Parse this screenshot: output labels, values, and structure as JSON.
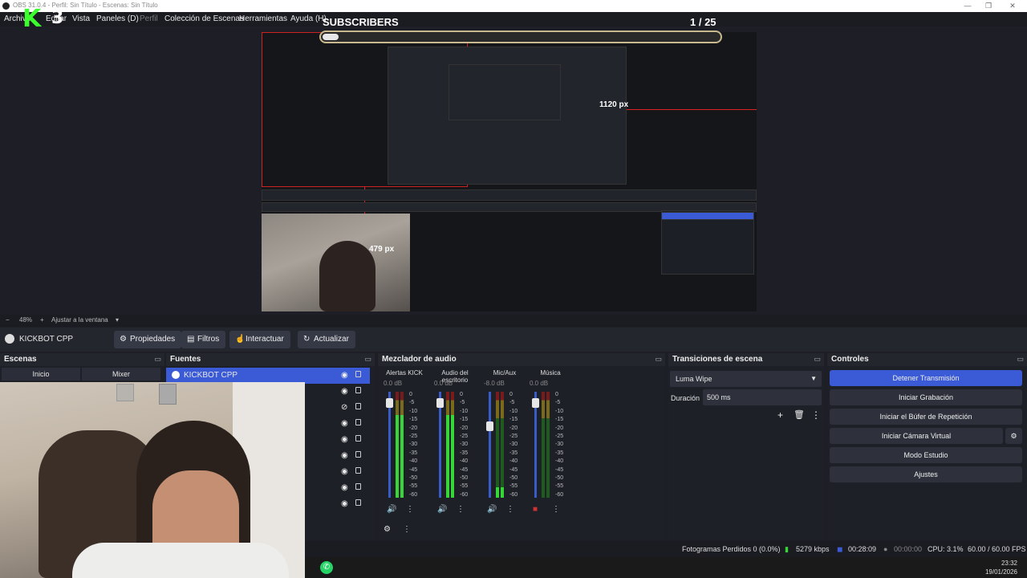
{
  "window": {
    "title": "OBS 31.0.4 - Perfil: Sin Título - Escenas: Sin Título"
  },
  "menu": {
    "items": [
      "Archivo",
      "Editar",
      "Vista",
      "Paneles (D)",
      "Perfil",
      "Colección de Escenas",
      "Herramientas",
      "Ayuda (H)"
    ]
  },
  "logo": {
    "letter": "K",
    "number": "3"
  },
  "subscribers": {
    "label": "SUBSCRIBERS",
    "count": "1  / 25",
    "progress": 0.04
  },
  "preview": {
    "labels": [
      "1120 px",
      "479 px"
    ]
  },
  "zoom": {
    "value": "48%",
    "fit": "Ajustar a la ventana",
    "minus": "−",
    "plus": "+"
  },
  "toolbar": {
    "source": "KICKBOT CPP",
    "properties": "Propiedades",
    "filters": "Filtros",
    "interact": "Interactuar",
    "refresh": "Actualizar"
  },
  "scenes": {
    "title": "Escenas",
    "cols": [
      "Inicio",
      "Mixer"
    ]
  },
  "sources": {
    "title": "Fuentes",
    "items": [
      "KICKBOT CPP"
    ]
  },
  "mixer": {
    "title": "Mezclador de audio",
    "channels": [
      {
        "name": "Alertas KICK",
        "db": "0.0 dB",
        "level": 0.78,
        "fader": 0.94
      },
      {
        "name": "Audio del escritorio",
        "db": "0.0 dB",
        "level": 0.78,
        "fader": 0.94
      },
      {
        "name": "Mic/Aux",
        "db": "-8.0 dB",
        "level": 0.1,
        "fader": 0.72
      },
      {
        "name": "Música",
        "db": "0.0 dB",
        "level": 0.0,
        "fader": 0.94
      }
    ],
    "scale": [
      "0",
      "-5",
      "-10",
      "-15",
      "-20",
      "-25",
      "-30",
      "-35",
      "-40",
      "-45",
      "-50",
      "-55",
      "-60"
    ]
  },
  "transitions": {
    "title": "Transiciones de escena",
    "selected": "Luma Wipe",
    "duration_label": "Duración",
    "duration": "500 ms"
  },
  "controls": {
    "title": "Controles",
    "buttons": [
      "Detener Transmisión",
      "Iniciar Grabación",
      "Iniciar el Búfer de Repetición",
      "Iniciar Cámara Virtual",
      "Modo Estudio",
      "Ajustes"
    ]
  },
  "status": {
    "dropped": "Fotogramas Perdidos 0 (0.0%)",
    "bitrate": "5279 kbps",
    "stream_time": "00:28:09",
    "rec_time": "00:00:00",
    "cpu": "CPU: 3.1%",
    "fps": "60.00 / 60.00 FPS"
  },
  "taskbar": {
    "time": "23:32",
    "date": "19/01/2026"
  },
  "colors": {
    "accent": "#3b5bd6",
    "logo_green": "#3cff2e",
    "record_red": "#d22"
  }
}
